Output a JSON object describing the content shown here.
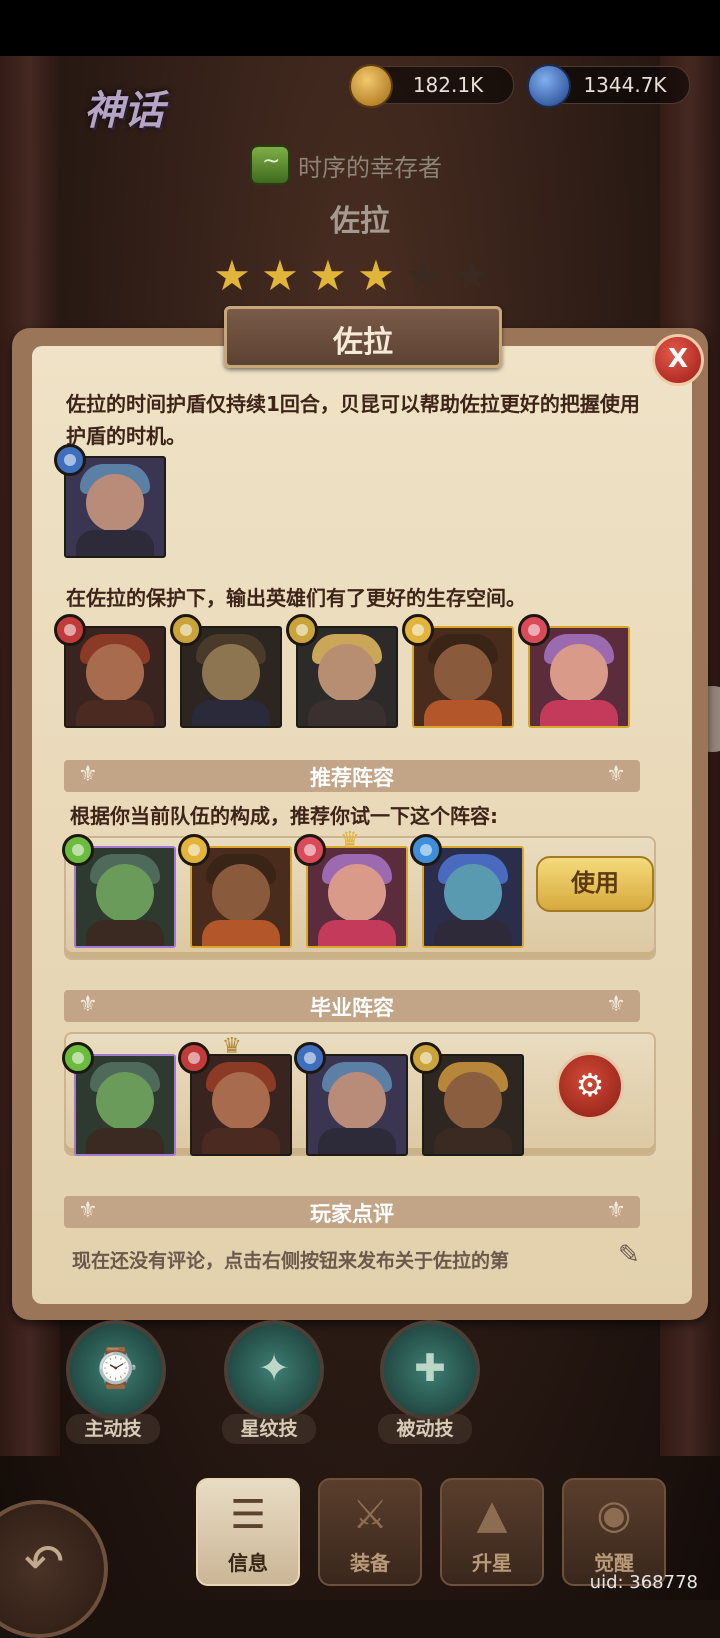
{
  "header": {
    "tier": "神话",
    "currencies": [
      {
        "name": "gold-coin-icon",
        "value": "182.1K",
        "color": "#d6a13b"
      },
      {
        "name": "blue-orb-icon",
        "value": "1344.7K",
        "color": "#3d73c6"
      }
    ],
    "faction_title": "时序的幸存者",
    "hero_name": "佐拉",
    "stars_filled": 4,
    "stars_total": 6
  },
  "dialog": {
    "title": "佐拉",
    "close_label": "X",
    "section1_text": "佐拉的时间护盾仅持续1回合，贝昆可以帮助佐拉更好的把握使用护盾的时机。",
    "section2_text": "在佐拉的保护下，输出英雄们有了更好的生存空间。",
    "recommended": {
      "banner": "推荐阵容",
      "text": "根据你当前队伍的构成，推荐你试一下这个阵容:",
      "use_label": "使用"
    },
    "graduate": {
      "banner": "毕业阵容"
    },
    "reviews": {
      "banner": "玩家点评",
      "text": "现在还没有评论，点击右侧按钮来发布关于佐拉的第"
    }
  },
  "skills": [
    {
      "label": "主动技",
      "icon": "clock-icon"
    },
    {
      "label": "星纹技",
      "icon": "star-pattern-icon"
    },
    {
      "label": "被动技",
      "icon": "passive-icon"
    }
  ],
  "tabs": [
    {
      "label": "信息",
      "icon": "info-icon",
      "active": true
    },
    {
      "label": "装备",
      "icon": "equipment-icon",
      "active": false
    },
    {
      "label": "升星",
      "icon": "star-up-icon",
      "active": false
    },
    {
      "label": "觉醒",
      "icon": "awaken-icon",
      "active": false
    }
  ],
  "uid": "uid: 368778"
}
